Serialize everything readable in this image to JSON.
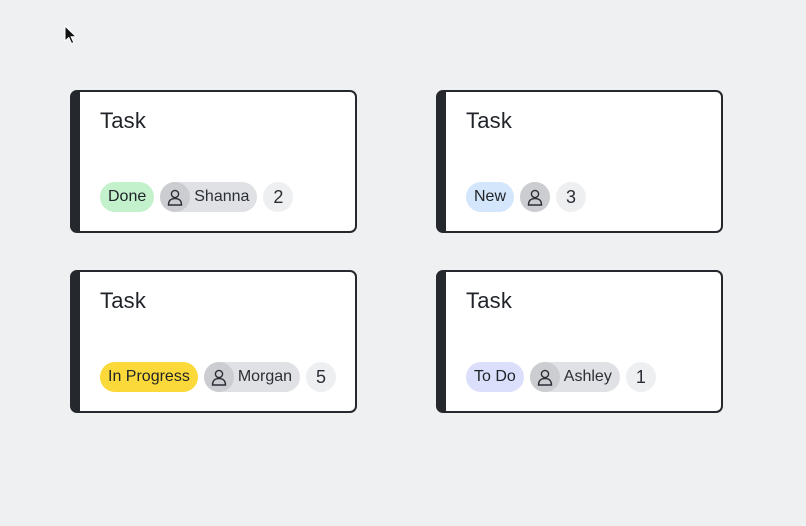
{
  "cards": [
    {
      "title": "Task",
      "status": "Done",
      "status_color": "#c3f1cc",
      "assignee": "Shanna",
      "count": "2"
    },
    {
      "title": "Task",
      "status": "New",
      "status_color": "#d4e6fb",
      "assignee": "",
      "count": "3"
    },
    {
      "title": "Task",
      "status": "In Progress",
      "status_color": "#fbd93a",
      "assignee": "Morgan",
      "count": "5"
    },
    {
      "title": "Task",
      "status": "To Do",
      "status_color": "#dcdffb",
      "assignee": "Ashley",
      "count": "1"
    }
  ],
  "icons": {
    "avatar": "user-icon",
    "cursor": "mouse-pointer-icon"
  }
}
